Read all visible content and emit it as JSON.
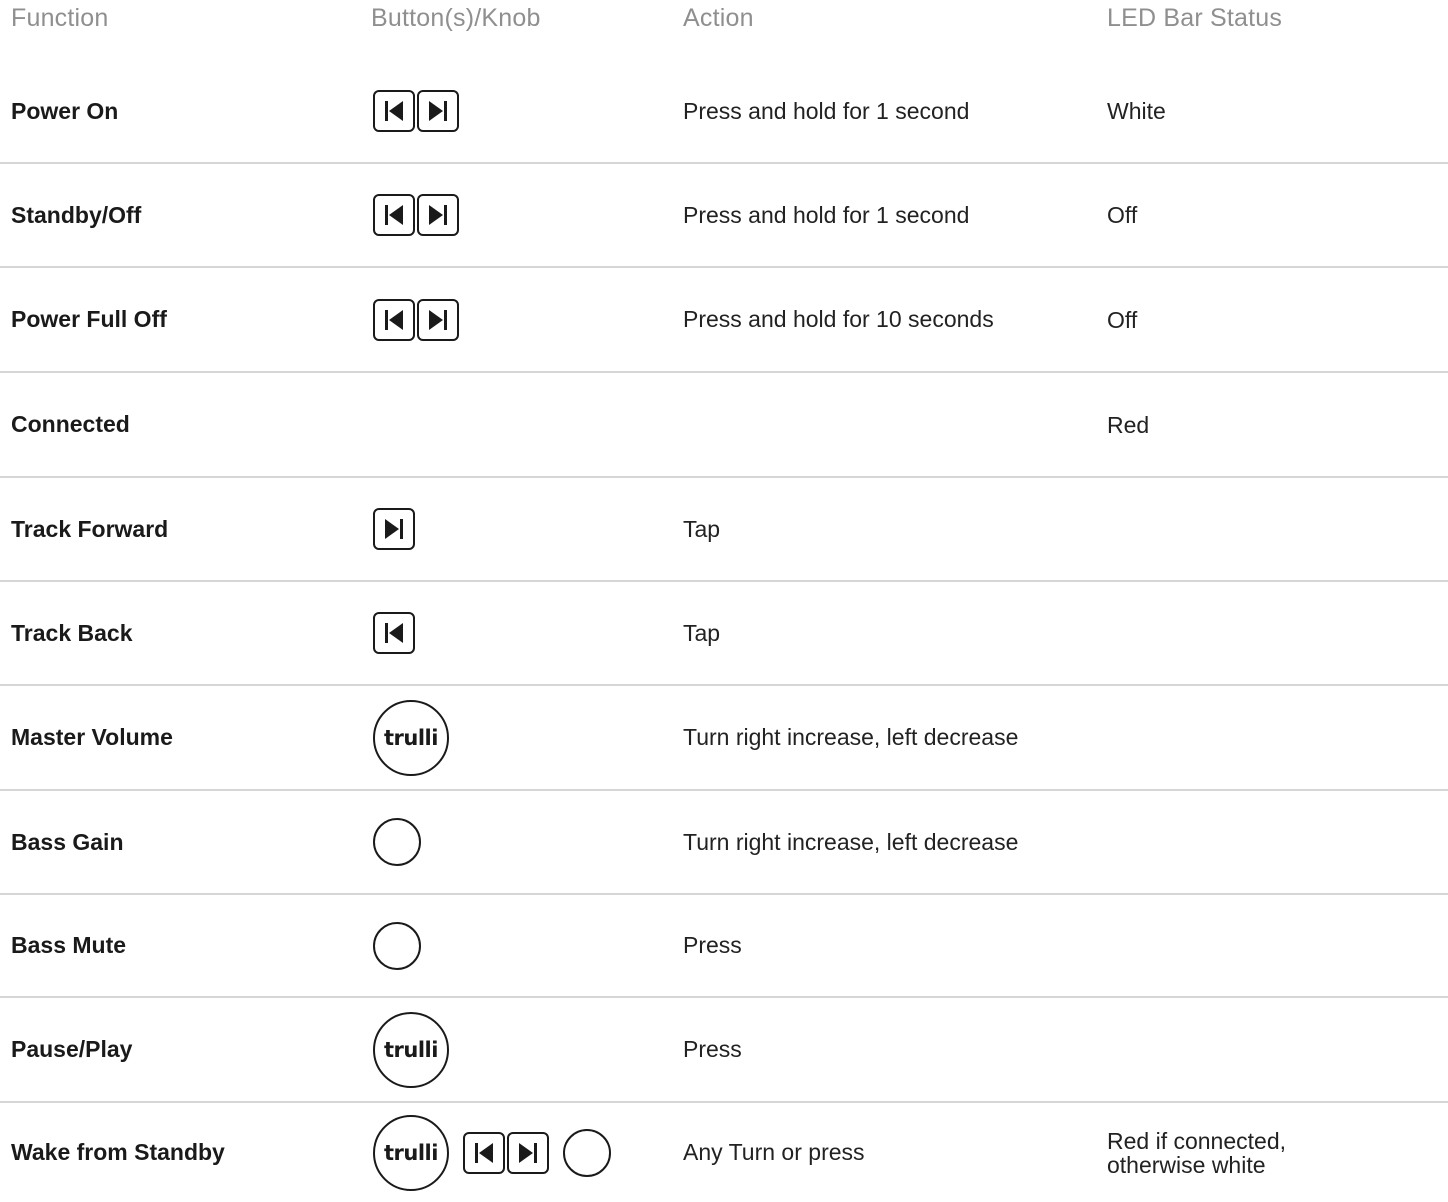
{
  "header": {
    "function": "Function",
    "buttons": "Button(s)/Knob",
    "action": "Action",
    "led": "LED Bar Status"
  },
  "rows": [
    {
      "function": "Power On",
      "controls": "prev-next",
      "action": "Press and hold for 1 second",
      "led": "White"
    },
    {
      "function": "Standby/Off",
      "controls": "prev-next",
      "action": "Press and hold for 1 second",
      "led": "Off"
    },
    {
      "function": "Power Full Off",
      "controls": "prev-next",
      "action": "Press and hold for 10 seconds",
      "led": "Off"
    },
    {
      "function": "Connected",
      "controls": "",
      "action": "",
      "led": "Red"
    },
    {
      "function": "Track Forward",
      "controls": "next",
      "action": "Tap",
      "led": ""
    },
    {
      "function": "Track Back",
      "controls": "prev",
      "action": "Tap",
      "led": ""
    },
    {
      "function": "Master Volume",
      "controls": "trulli-knob",
      "action": "Turn right increase, left decrease",
      "led": ""
    },
    {
      "function": "Bass Gain",
      "controls": "plain-knob",
      "action": "Turn right increase, left decrease",
      "led": ""
    },
    {
      "function": "Bass Mute",
      "controls": "plain-knob",
      "action": "Press",
      "led": ""
    },
    {
      "function": "Pause/Play",
      "controls": "trulli-knob",
      "action": "Press",
      "led": ""
    },
    {
      "function": "Wake from Standby",
      "controls": "all",
      "action": "Any Turn or press",
      "led_line1": "Red if connected,",
      "led_line2": "otherwise white"
    }
  ],
  "knob_logo": "trulli",
  "icons": {
    "prev": "skip-back-icon",
    "next": "skip-forward-icon",
    "knob": "knob-icon"
  },
  "colors": {
    "header_text": "#8f8f8f",
    "divider": "#d6d6d6",
    "ink": "#1a1a1a"
  }
}
